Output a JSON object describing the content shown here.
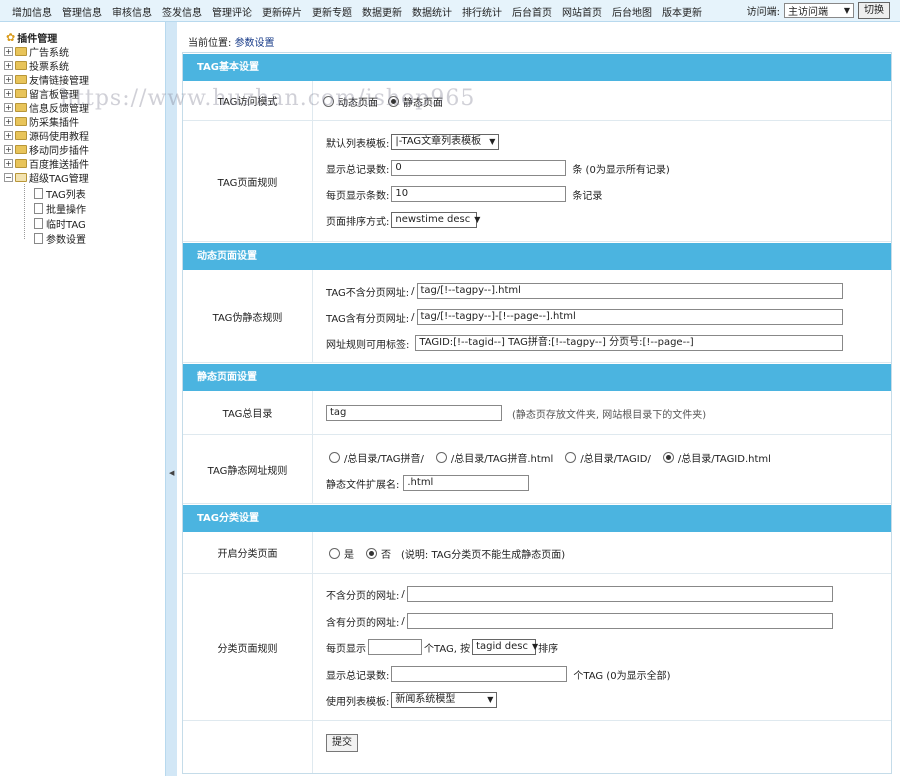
{
  "topnav": [
    "增加信息",
    "管理信息",
    "审核信息",
    "签发信息",
    "管理评论",
    "更新碎片",
    "更新专题",
    "数据更新",
    "数据统计",
    "排行统计",
    "后台首页",
    "网站首页",
    "后台地图",
    "版本更新"
  ],
  "visit": {
    "label": "访问端:",
    "selected": "主访问端",
    "button": "切换"
  },
  "tree": {
    "root": "插件管理",
    "items": [
      "广告系统",
      "投票系统",
      "友情链接管理",
      "留言板管理",
      "信息反馈管理",
      "防采集插件",
      "源码使用教程",
      "移动同步插件",
      "百度推送插件",
      "超级TAG管理"
    ],
    "children": [
      "TAG列表",
      "批量操作",
      "临时TAG",
      "参数设置"
    ]
  },
  "breadcrumb": {
    "prefix": "当前位置:",
    "current": "参数设置"
  },
  "watermark": "https://www.huzhan.com/ishop965",
  "sections": {
    "basic": "TAG基本设置",
    "dynamic": "动态页面设置",
    "static": "静态页面设置",
    "category": "TAG分类设置"
  },
  "basic": {
    "mode_label": "TAG访问模式",
    "mode_options": [
      "动态页面",
      "静态页面"
    ],
    "rule_label": "TAG页面规则",
    "tpl_label": "默认列表模板:",
    "tpl_value": "|-TAG文章列表模板",
    "total_label": "显示总记录数:",
    "total_value": "0",
    "total_suffix": "条 (0为显示所有记录)",
    "perpage_label": "每页显示条数:",
    "perpage_value": "10",
    "perpage_suffix": "条记录",
    "sort_label": "页面排序方式:",
    "sort_value": "newstime desc"
  },
  "dynamic": {
    "label": "TAG伪静态规则",
    "nopage_label": "TAG不含分页网址:",
    "nopage_value": "tag/[!--tagpy--].html",
    "page_label": "TAG含有分页网址:",
    "page_value": "tag/[!--tagpy--]-[!--page--].html",
    "tags_label": "网址规则可用标签:",
    "tags_value": "TAGID:[!--tagid--]  TAG拼音:[!--tagpy--]  分页号:[!--page--]",
    "slash": "/"
  },
  "static": {
    "dir_label": "TAG总目录",
    "dir_value": "tag",
    "dir_note": "(静态页存放文件夹, 网站根目录下的文件夹)",
    "url_label": "TAG静态网址规则",
    "url_options": [
      "/总目录/TAG拼音/",
      "/总目录/TAG拼音.html",
      "/总目录/TAGID/",
      "/总目录/TAGID.html"
    ],
    "ext_label": "静态文件扩展名:",
    "ext_value": ".html"
  },
  "category": {
    "open_label": "开启分类页面",
    "yes": "是",
    "no": "否",
    "open_note": "(说明: TAG分类页不能生成静态页面)",
    "rule_label": "分类页面规则",
    "nopage_label": "不含分页的网址:",
    "page_label": "含有分页的网址:",
    "slash": "/",
    "perpage_label": "每页显示",
    "perpage_mid": "个TAG, 按",
    "perpage_sort": "tagid desc",
    "perpage_suffix": "排序",
    "total_label": "显示总记录数:",
    "total_suffix": "个TAG (0为显示全部)",
    "tpl_label": "使用列表模板:",
    "tpl_value": "新闻系统模型"
  },
  "submit": "提交"
}
